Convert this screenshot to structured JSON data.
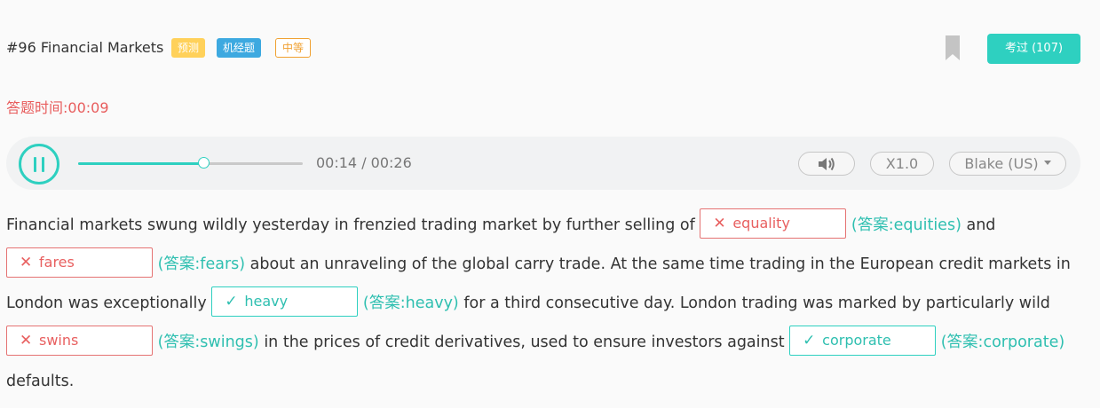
{
  "header": {
    "title": "#96 Financial Markets",
    "tags": {
      "predict": "预测",
      "jijing": "机经题",
      "level": "中等"
    },
    "passed_label": "考过 (107)"
  },
  "timer": {
    "label": "答题时间:",
    "value": "00:09"
  },
  "player": {
    "current": "00:14",
    "total": "00:26",
    "progress": 0.56,
    "speed": "X1.0",
    "voice": "Blake (US)"
  },
  "passage": {
    "t1": "Financial markets swung wildly yesterday in frenzied trading market by further selling of ",
    "a1": {
      "value": "equality",
      "answer": "(答案:equities)",
      "status": "wrong"
    },
    "t2": " and ",
    "a2": {
      "value": "fares",
      "answer": "(答案:fears)",
      "status": "wrong"
    },
    "t3": " about an unraveling of the global carry trade. At the same time trading in the European credit markets in London was exceptionally ",
    "a3": {
      "value": "heavy",
      "answer": "(答案:heavy)",
      "status": "right"
    },
    "t4": " for a third consecutive day. London trading was marked by particularly wild ",
    "a4": {
      "value": "swins",
      "answer": "(答案:swings)",
      "status": "wrong"
    },
    "t5": " in the prices of credit derivatives, used to ensure investors against ",
    "a5": {
      "value": "corporate",
      "answer": "(答案:corporate)",
      "status": "right"
    },
    "t6": " defaults."
  },
  "icons": {
    "wrong": "✕",
    "right": "✓"
  },
  "colors": {
    "accent": "#2ed0c0",
    "error": "#e57373",
    "tag_predict": "#ffd15a",
    "tag_jijing": "#3da9e0",
    "tag_level": "#f0a030"
  }
}
